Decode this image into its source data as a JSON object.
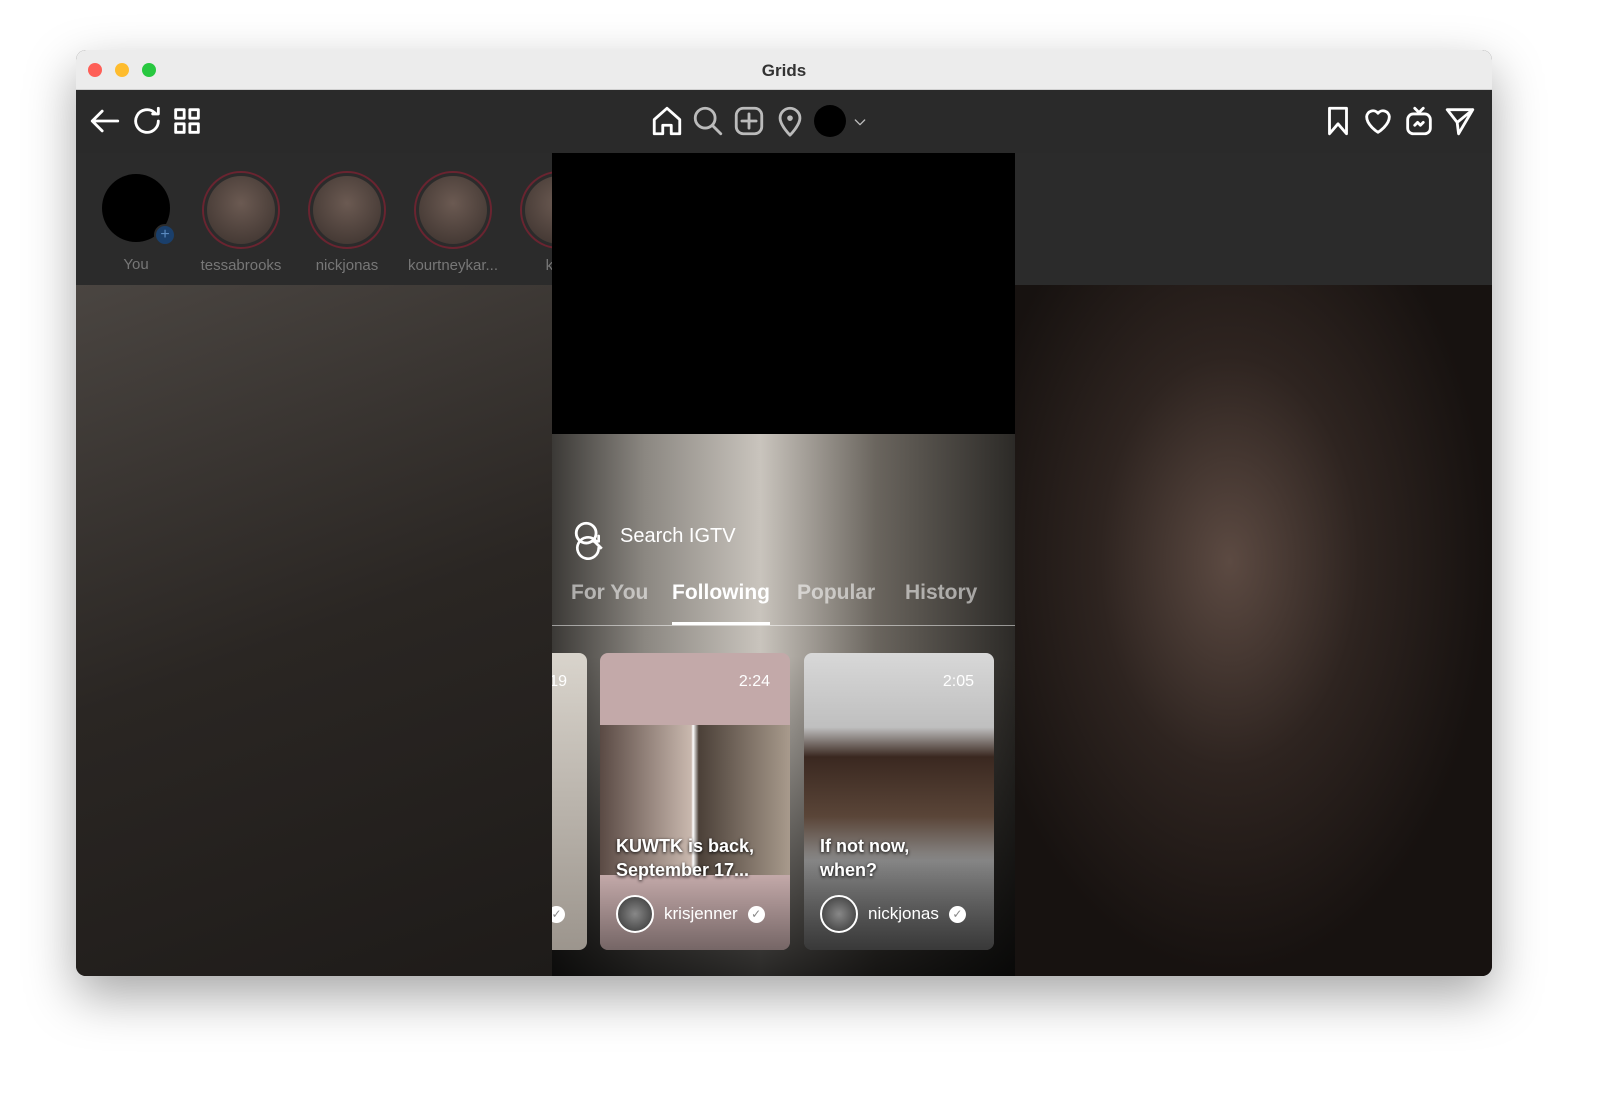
{
  "window": {
    "title": "Grids"
  },
  "toolbar": {
    "left_icons": [
      "back-arrow-icon",
      "refresh-icon",
      "grid-icon"
    ],
    "center_icons": [
      "home-icon",
      "search-icon",
      "add-post-icon",
      "location-pin-icon",
      "profile-avatar",
      "chevron-down-icon"
    ],
    "right_icons": [
      "bookmark-icon",
      "heart-icon",
      "igtv-icon",
      "send-icon"
    ]
  },
  "stories": [
    {
      "name": "You"
    },
    {
      "name": "tessabrooks"
    },
    {
      "name": "nickjonas"
    },
    {
      "name": "kourtneykar..."
    },
    {
      "name": "krisj"
    }
  ],
  "igtv": {
    "search_placeholder": "Search IGTV",
    "tabs": [
      {
        "label": "For You"
      },
      {
        "label": "Following",
        "active": true
      },
      {
        "label": "Popular"
      },
      {
        "label": "History"
      }
    ],
    "cards": [
      {
        "duration": "19"
      },
      {
        "duration": "2:24",
        "title": "KUWTK is back, September 17...",
        "user": "krisjenner",
        "verified": true
      },
      {
        "duration": "2:05",
        "title": "If not now, when?",
        "user": "nickjonas",
        "verified": true
      }
    ]
  },
  "colors": {
    "toolbar": "#2a2a2a",
    "story_ring": "#6a2430",
    "accent_plus": "#1e6fd9"
  }
}
